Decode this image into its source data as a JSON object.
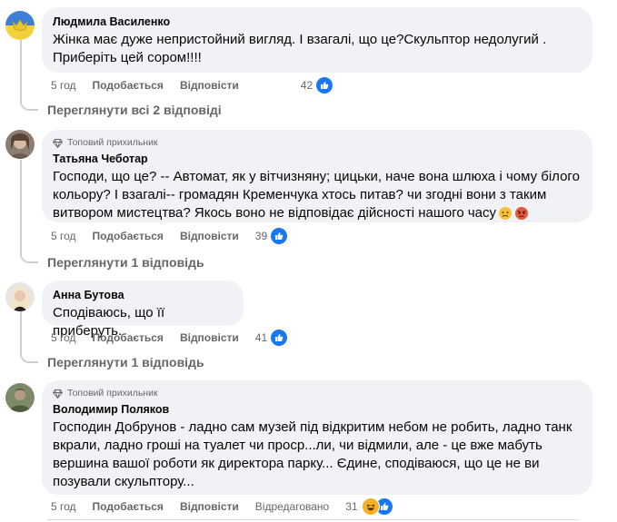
{
  "comments": [
    {
      "author": "Людмила Василенко",
      "text_line1": "Жінка має дуже непристойний вигляд. І взагалі, що це?Скульптор недолугий .",
      "text_line2": "Приберіть цей сором!!!!",
      "time": "5 год",
      "like_label": "Подобається",
      "reply_label": "Відповісти",
      "reaction_count": "42",
      "view_replies": "Переглянути всі 2 відповіді"
    },
    {
      "badge": "Топовий прихильник",
      "author": "Татьяна Чеботар",
      "text_line1": "Господи, що це? -- Автомат, як у вітчизняну; цицьки, наче вона шлюха і чому білого",
      "text_line2": "кольору? І взагалі-- громадян Кременчука хтось питав? чи згодні вони з таким",
      "text_line3": "витвором мистецтва? Якось воно не відповідає дійсності нашого часу",
      "time": "5 год",
      "like_label": "Подобається",
      "reply_label": "Відповісти",
      "reaction_count": "39",
      "view_replies": "Переглянути 1 відповідь"
    },
    {
      "author": "Анна Бутова",
      "text_line1": "Сподіваюсь, що її приберуть.",
      "time": "5 год",
      "like_label": "Подобається",
      "reply_label": "Відповісти",
      "reaction_count": "41",
      "view_replies": "Переглянути 1 відповідь"
    },
    {
      "badge": "Топовий прихильник",
      "author": "Володимир Поляков",
      "text_line1": "Господин Добрунов - ладно сам музей під відкритим небом не робить, ладно танк",
      "text_line2": "вкрали, ладно гроші на туалет чи проср...ли, чи відмили, але - це вже мабуть",
      "text_line3": "вершина вашої роботи як директора парку... Єдине, сподіваюся, що це не ви",
      "text_line4": "позували скульптору...",
      "time": "5 год",
      "like_label": "Подобається",
      "reply_label": "Відповісти",
      "edited_label": "Відредаговано",
      "reaction_count": "31"
    }
  ],
  "colors": {
    "bubble": "#f0f2f5",
    "meta_text": "#65676b",
    "like_blue": "#1877f2",
    "laugh_yellow": "#f7b125",
    "thread_line": "#ccd0d5"
  }
}
